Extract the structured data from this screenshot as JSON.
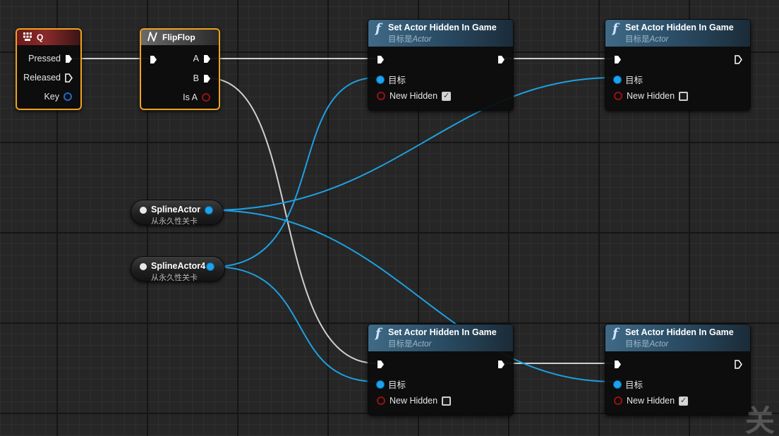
{
  "event_node": {
    "title": "Q",
    "pins": {
      "pressed": "Pressed",
      "released": "Released",
      "key": "Key"
    },
    "header_color": "#7a1f1f",
    "icon": "keyboard-icon"
  },
  "flipflop_node": {
    "title": "FlipFlop",
    "pins": {
      "a": "A",
      "b": "B",
      "is_a": "Is A"
    },
    "icon": "flipflop-icon"
  },
  "spline_actor_1": {
    "name": "SplineActor",
    "subtitle": "从永久性关卡"
  },
  "spline_actor_2": {
    "name": "SplineActor4",
    "subtitle": "从永久性关卡"
  },
  "set_hidden_nodes": [
    {
      "title": "Set Actor Hidden In Game",
      "subtitle_prefix": "目标是",
      "subtitle_class": "Actor",
      "target_label": "目标",
      "param_label": "New Hidden",
      "new_hidden_checked": true
    },
    {
      "title": "Set Actor Hidden In Game",
      "subtitle_prefix": "目标是",
      "subtitle_class": "Actor",
      "target_label": "目标",
      "param_label": "New Hidden",
      "new_hidden_checked": false
    },
    {
      "title": "Set Actor Hidden In Game",
      "subtitle_prefix": "目标是",
      "subtitle_class": "Actor",
      "target_label": "目标",
      "param_label": "New Hidden",
      "new_hidden_checked": false
    },
    {
      "title": "Set Actor Hidden In Game",
      "subtitle_prefix": "目标是",
      "subtitle_class": "Actor",
      "target_label": "目标",
      "param_label": "New Hidden",
      "new_hidden_checked": true
    }
  ],
  "corner_text": "关",
  "colors": {
    "exec_wire": "#d8d8d8",
    "object_wire": "#1ea0e0",
    "selection_outline": "#f0a21e",
    "function_header": "#3f6a86",
    "object_pin": "#1aa3f0",
    "bool_pin": "#9a1010"
  }
}
